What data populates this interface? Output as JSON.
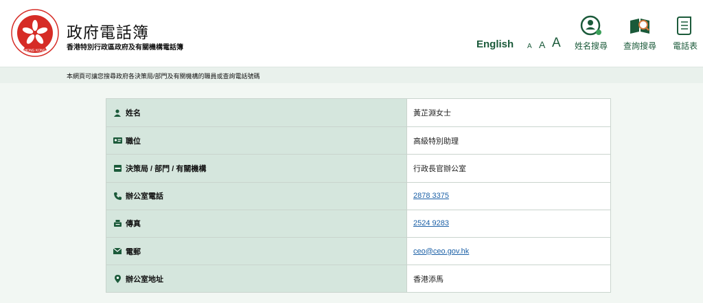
{
  "header": {
    "title": "政府電話簿",
    "subtitle": "香港特別行政區政府及有關機構電話簿",
    "logo_text": "HONG KONG",
    "language_link": "English",
    "font_size": {
      "small": "A",
      "medium": "A",
      "large": "A"
    },
    "nav": [
      {
        "label": "姓名搜尋",
        "icon": "person-search-icon"
      },
      {
        "label": "查詢搜尋",
        "icon": "book-search-icon"
      },
      {
        "label": "電話表",
        "icon": "scroll-icon"
      }
    ]
  },
  "subheader": {
    "text": "本網頁可讓您搜尋政府各決策局/部門及有關機構的職員或查詢電話號碼"
  },
  "record": {
    "rows": [
      {
        "label": "姓名",
        "value": "黃芷淵女士",
        "icon": "person-icon",
        "link": false
      },
      {
        "label": "職位",
        "value": "高級特別助理",
        "icon": "id-card-icon",
        "link": false
      },
      {
        "label": "決策局 / 部門 / 有關機構",
        "value": "行政長官辦公室",
        "icon": "inbox-icon",
        "link": false
      },
      {
        "label": "辦公室電話",
        "value": "2878 3375",
        "icon": "phone-icon",
        "link": true
      },
      {
        "label": "傳真",
        "value": "2524 9283",
        "icon": "fax-icon",
        "link": true
      },
      {
        "label": "電郵",
        "value": "ceo@ceo.gov.hk",
        "icon": "envelope-icon",
        "link": true
      },
      {
        "label": "辦公室地址",
        "value": "香港添馬",
        "icon": "map-pin-icon",
        "link": false
      }
    ]
  },
  "colors": {
    "brand_green": "#1b5a3a",
    "label_bg": "#d5e6dd",
    "page_bg": "#f2f7f3",
    "link": "#1a5fa6",
    "logo_red": "#d62c26"
  }
}
